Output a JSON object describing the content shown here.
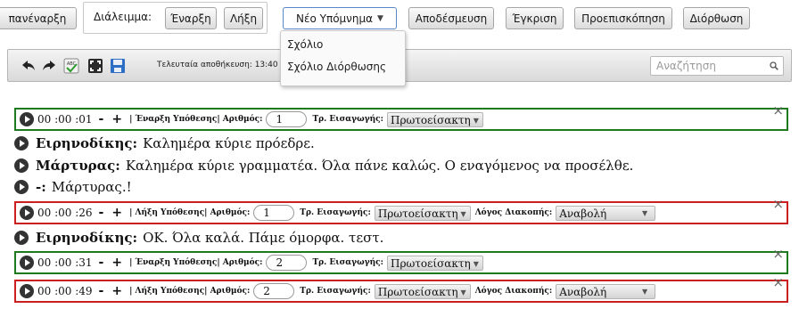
{
  "toolbar": {
    "restart_label": "πανέναρξη",
    "break_label": "Διάλειμμα:",
    "start_label": "Έναρξη",
    "end_label": "Λήξη",
    "new_note_label": "Νέο Υπόμνημα",
    "release_label": "Αποδέσμευση",
    "approve_label": "Έγκριση",
    "preview_label": "Προεπισκόπηση",
    "correct_label": "Διόρθωση"
  },
  "note_menu": {
    "items": [
      "Σχόλιο",
      "Σχόλιο Διόρθωσης"
    ]
  },
  "editor_bar": {
    "saved_text": "Τελευταία αποθήκευση: 13:40",
    "search_placeholder": "Αναζήτηση"
  },
  "labels": {
    "start_hypothesis": "| Έναρξη Υπόθεσης| Αριθμός:",
    "end_hypothesis": "| Λήξη Υπόθεσης| Αριθμός:",
    "entry_type": "Τρ. Εισαγωγής:",
    "break_reason": "Λόγος Διακοπής:",
    "minus": "-",
    "plus": "+",
    "close": "×"
  },
  "markers": [
    {
      "time": "00 :00 :01",
      "number": "1",
      "entry": "Πρωτοείσακτη",
      "reason": ""
    },
    {
      "time": "00 :00 :26",
      "number": "1",
      "entry": "Πρωτοείσακτη",
      "reason": "Αναβολή"
    },
    {
      "time": "00 :00 :31",
      "number": "2",
      "entry": "Πρωτοείσακτη",
      "reason": ""
    },
    {
      "time": "00 :00 :49",
      "number": "2",
      "entry": "Πρωτοείσακτη",
      "reason": "Αναβολή"
    }
  ],
  "speeches": [
    {
      "speaker": "Ειρηνοδίκης:",
      "text": "Καλημέρα κύριε πρόεδρε."
    },
    {
      "speaker": "Μάρτυρας:",
      "text": "Καλημέρα κύριε γραμματέα.  Όλα πάνε καλώς. Ο εναγόμενος να προσέλθε."
    },
    {
      "speaker": "-:",
      "text": "Μάρτυρας.!"
    },
    {
      "speaker": "Ειρηνοδίκης:",
      "text": "ΟΚ. Όλα καλά. Πάμε όμορφα. τεστ."
    }
  ],
  "colors": {
    "start_border": "#1f7a1f",
    "end_border": "#cc1f1f"
  }
}
